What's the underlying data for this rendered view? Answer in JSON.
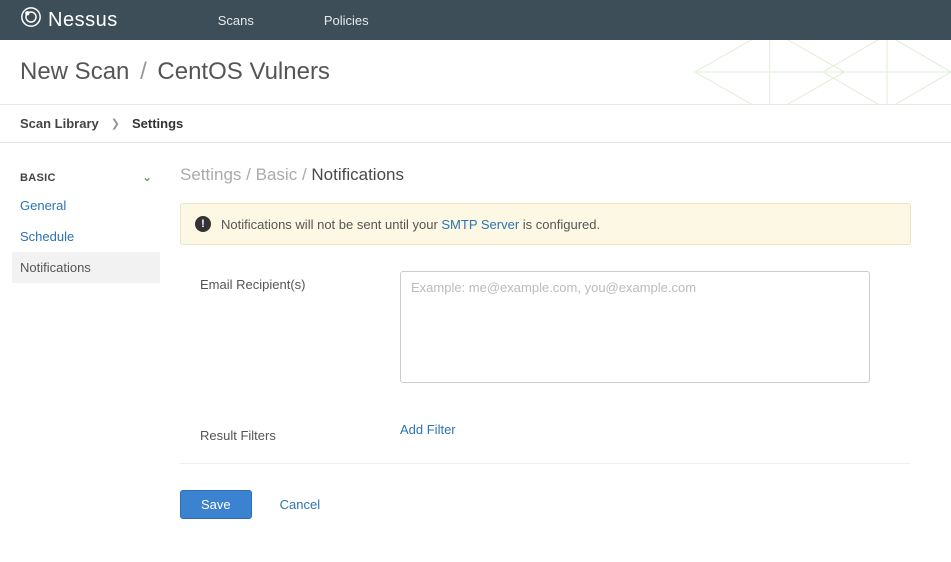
{
  "brand": "Nessus",
  "topnav": {
    "scans": "Scans",
    "policies": "Policies"
  },
  "header": {
    "title": "New Scan",
    "subtitle": "CentOS Vulners"
  },
  "subnav": {
    "lib": "Scan Library",
    "settings": "Settings"
  },
  "sidebar": {
    "section": "BASIC",
    "items": {
      "general": "General",
      "schedule": "Schedule",
      "notifications": "Notifications"
    }
  },
  "breadcrumb": {
    "a": "Settings",
    "b": "Basic",
    "c": "Notifications"
  },
  "notice": {
    "pre": "Notifications will not be sent until your ",
    "link": "SMTP Server",
    "post": " is configured."
  },
  "form": {
    "email_label": "Email Recipient(s)",
    "email_placeholder": "Example: me@example.com, you@example.com",
    "email_value": "",
    "filters_label": "Result Filters",
    "add_filter": "Add Filter"
  },
  "actions": {
    "save": "Save",
    "cancel": "Cancel"
  }
}
